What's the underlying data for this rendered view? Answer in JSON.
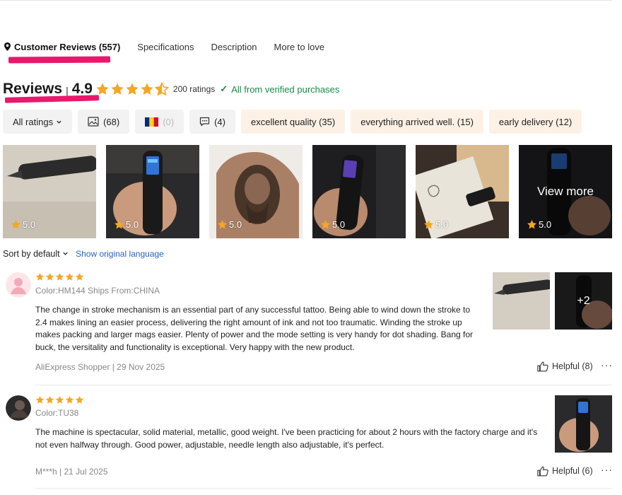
{
  "tabs": [
    {
      "label": "Customer Reviews (557)"
    },
    {
      "label": "Specifications"
    },
    {
      "label": "Description"
    },
    {
      "label": "More to love"
    }
  ],
  "summary": {
    "title": "Reviews",
    "separator": "|",
    "score": "4.9",
    "ratings_count": "200 ratings",
    "verified": "All from verified purchases"
  },
  "filters": {
    "all_ratings": "All ratings",
    "photos": "(68)",
    "country": "(0)",
    "comments": "(4)",
    "tags": [
      {
        "label": "excellent quality (35)"
      },
      {
        "label": "everything arrived well. (15)"
      },
      {
        "label": "early delivery (12)"
      }
    ]
  },
  "photos": [
    {
      "rating": "5.0"
    },
    {
      "rating": "5.0"
    },
    {
      "rating": "5.0"
    },
    {
      "rating": "5.0"
    },
    {
      "rating": "5.0"
    },
    {
      "rating": "5.0",
      "overlay": "View more"
    }
  ],
  "sort": {
    "label": "Sort by default",
    "original_language": "Show original language"
  },
  "reviews": [
    {
      "meta": "Color:HM144 Ships From:CHINA",
      "text": "The change in stroke mechanism is an essential part of any successful tattoo. Being able to wind down the stroke to 2.4 makes lining an easier process, delivering the right amount of ink and not too traumatic. Winding the stroke up makes packing and larger mags easier. Plenty of power and the mode setting is very handy for dot shading. Bang for buck, the versitality and functionality is exceptional. Very happy with the new product.",
      "author_date": "AliExpress Shopper | 29 Nov 2025",
      "helpful": "Helpful (8)",
      "more_photos": "+2"
    },
    {
      "meta": "Color:TU38",
      "text": "The machine is spectacular, solid material, metallic, good weight. I've been practicing for about 2 hours with the factory charge and it's not even halfway through. Good power, adjustable, needle length also adjustable, it's perfect.",
      "author_date": "M***h | 21 Jul 2025",
      "helpful": "Helpful (6)"
    }
  ],
  "colors": {
    "star": "#f5a623",
    "verified": "#1a8a4a",
    "link": "#2a63c4",
    "highlight_mark": "#e8196b",
    "tag_bg": "#fdf1e6"
  }
}
